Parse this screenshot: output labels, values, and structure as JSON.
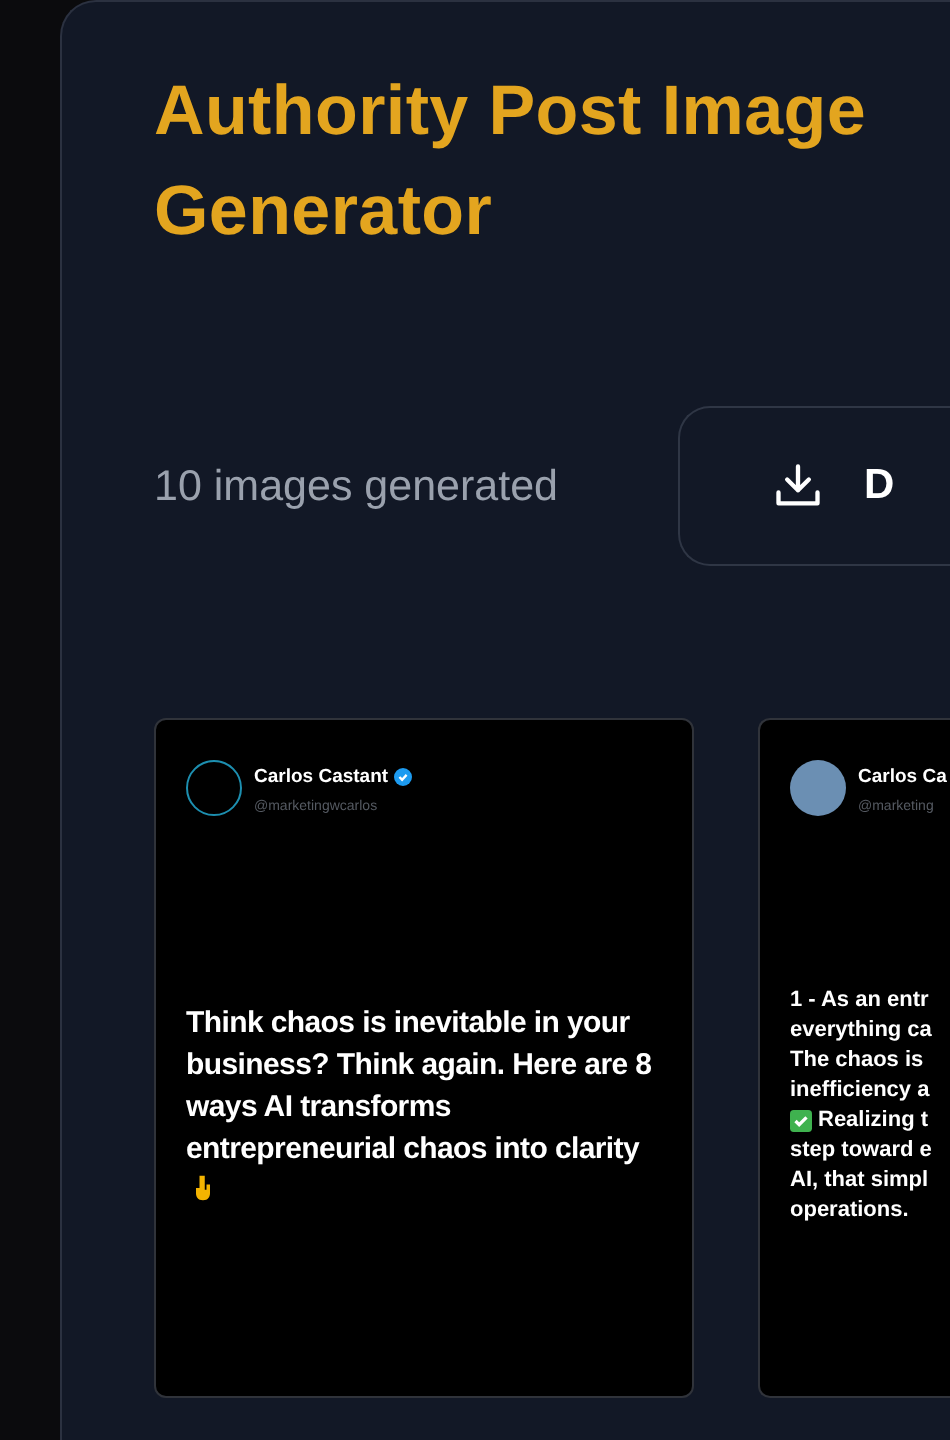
{
  "title": "Authority Post Image Generator",
  "count_label": "10 images generated",
  "download_button": {
    "label": "D"
  },
  "cards": [
    {
      "name": "Carlos Castant",
      "verified": true,
      "handle": "@marketingwcarlos",
      "avatar": {
        "kind": "ring"
      },
      "lines": [
        {
          "text": "Think chaos is inevitable in your business? Think again. Here are 8 ways AI transforms entrepreneurial chaos into clarity",
          "kind": "pointing"
        }
      ]
    },
    {
      "name": "Carlos Ca",
      "handle": "@marketing",
      "avatar": {
        "kind": "photo"
      },
      "lines": [
        {
          "text": "1 - As an entr"
        },
        {
          "text": "everything ca"
        },
        {
          "text": "The chaos is"
        },
        {
          "text": "inefficiency a"
        },
        {
          "text": "Realizing t",
          "kind": "checked"
        },
        {
          "text": "step toward e"
        },
        {
          "text": "AI, that simpl"
        },
        {
          "text": "operations."
        }
      ]
    }
  ]
}
